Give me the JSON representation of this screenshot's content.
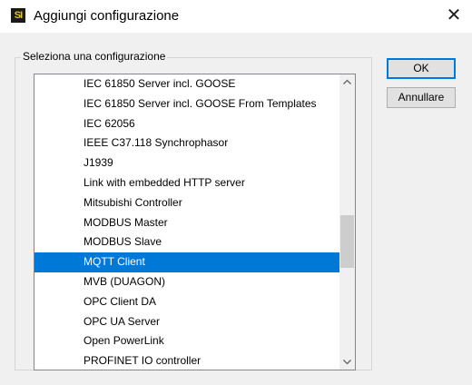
{
  "window": {
    "icon_text": "SI",
    "title": "Aggiungi configurazione",
    "close_glyph": "✕"
  },
  "group": {
    "legend": "Seleziona una configurazione"
  },
  "list": {
    "items": [
      "IEC 61850 Server incl. GOOSE",
      "IEC 61850 Server incl. GOOSE From Templates",
      "IEC 62056",
      "IEEE C37.118 Synchrophasor",
      "J1939",
      "Link with embedded HTTP server",
      "Mitsubishi Controller",
      "MODBUS Master",
      "MODBUS Slave",
      "MQTT Client",
      "MVB (DUAGON)",
      "OPC Client DA",
      "OPC UA Server",
      "Open PowerLink",
      "PROFINET IO controller"
    ],
    "selected": "MQTT Client",
    "scroll_up_glyph": "⌃",
    "scroll_down_glyph": "⌄",
    "scroll_position": 0.46
  },
  "buttons": {
    "ok": "OK",
    "cancel": "Annullare"
  },
  "colors": {
    "selection": "#0078d7",
    "dialog_bg": "#f0f0f0"
  }
}
